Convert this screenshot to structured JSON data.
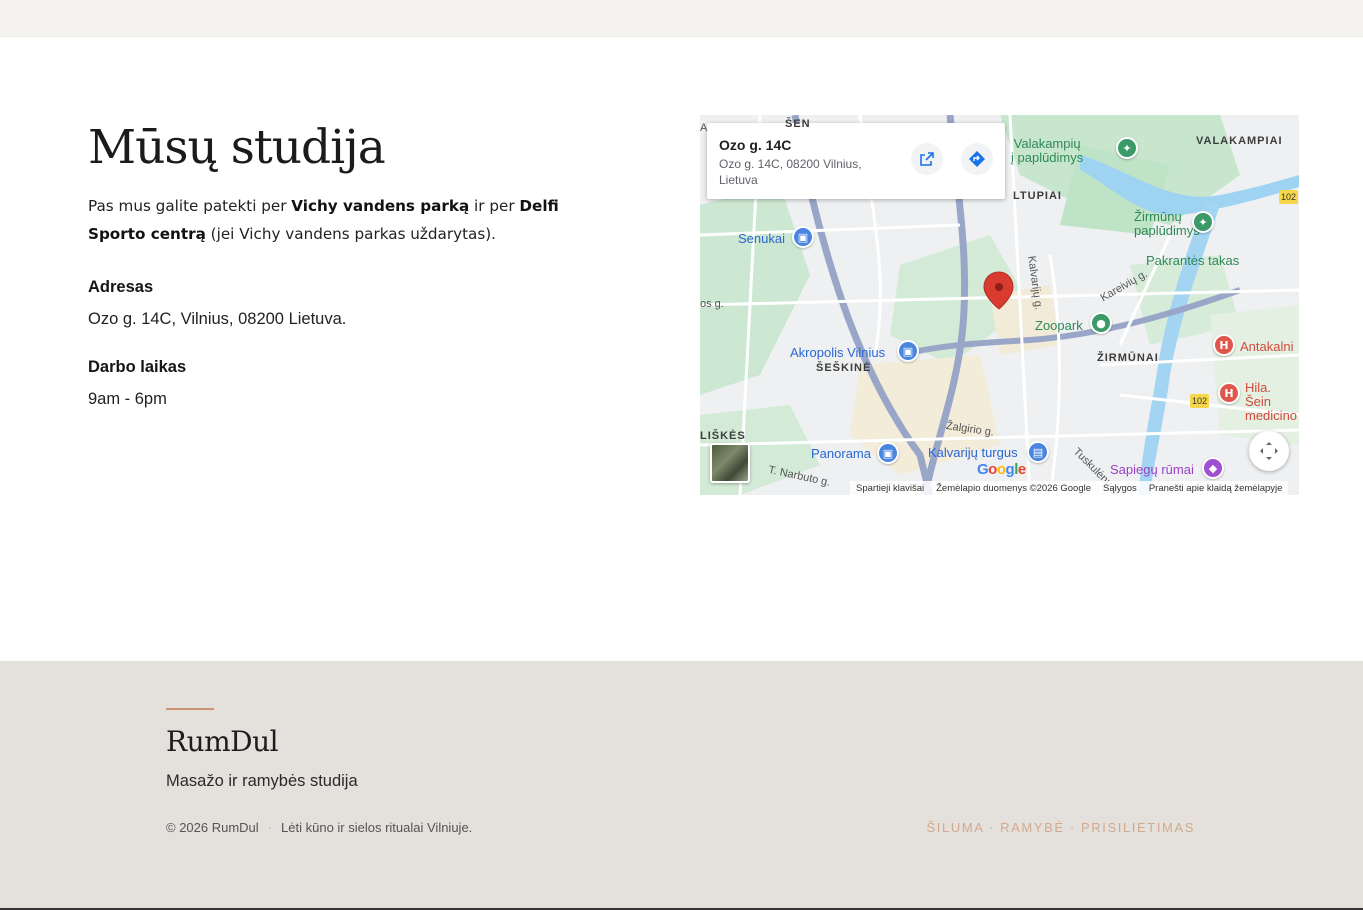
{
  "studio": {
    "title": "Mūsų studija",
    "intro": {
      "part1": "Pas mus galite patekti per ",
      "bold1": "Vichy vandens parką",
      "part2": " ir per ",
      "bold2": "Delfi Sporto centrą",
      "part3": " (jei Vichy vandens parkas uždarytas)."
    },
    "address_label": "Adresas",
    "address_value": "Ozo g. 14C, Vilnius, 08200 Lietuva.",
    "hours_label": "Darbo laikas",
    "hours_value": "9am - 6pm"
  },
  "map": {
    "card_title": "Ozo g. 14C",
    "card_address": "Ozo g. 14C, 08200 Vilnius, Lietuva",
    "labels": {
      "valakampiu": "Valakampių\nį paplūdimys",
      "valakampiai": "VALAKAMPIAI",
      "zirmunu_pap": "Žirmūnų\npaplūdimys",
      "pakrantes": "Pakrantės takas",
      "senukai": "Senukai",
      "zoopark": "Zoopark",
      "zirmunai": "ŽIRMŪNAI",
      "akropolis": "Akropolis Vilnius",
      "seskine": "ŠEŠKINĖ",
      "antakalnio": "Antakalni",
      "hila": "Hila. Šein\nmedicino",
      "panorama": "Panorama",
      "kalvariju": "Kalvarijų turgus",
      "sapiegu": "Sapiegų rūmai",
      "liskes": "LIŠKĖS",
      "ltupiai": "LTUPIAI",
      "sen": "ŠEN",
      "kalvariju_g": "Kalvarijų g.",
      "kareiviu_g": "Kareivių g.",
      "zalgirio_g": "Žalgirio g.",
      "narbuto_g": "T. Narbuto g.",
      "tuskulenu": "Tuskulėnų g.",
      "ozo_g": "os g.",
      "route_102": "102",
      "route_102b": "102",
      "route_a": "A"
    },
    "google": "Google",
    "attribution": {
      "shortcuts": "Spartieji klavišai",
      "data": "Žemėlapio duomenys ©2026 Google",
      "terms": "Sąlygos",
      "report": "Pranešti apie klaidą žemėlapyje"
    }
  },
  "footer": {
    "brand": "RumDul",
    "tagline": "Masažo ir ramybės studija",
    "copyright": "© 2026 RumDul",
    "slogan": "Lėti kūno ir sielos ritualai Vilniuje.",
    "motto": "ŠILUMA · RAMYBĖ · PRISILIETIMAS"
  },
  "colors": {
    "accent": "#c99574",
    "footer_bg": "#e4e0db",
    "motto": "#d2aa8e",
    "map_marker": "#d93b30"
  },
  "icons": {
    "open_external": "open-in-new-icon",
    "directions": "directions-icon",
    "fullscreen": "fullscreen-icon",
    "marker": "map-pin-icon"
  }
}
